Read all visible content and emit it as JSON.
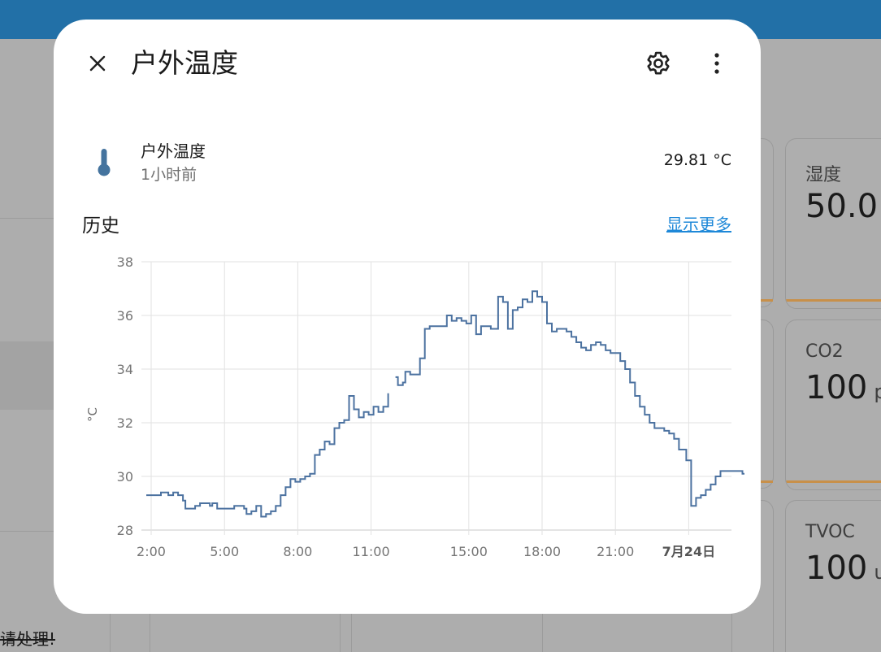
{
  "colors": {
    "topbar": "#2270a7",
    "backdrop": "#adadad",
    "series_line": "#4c72a0",
    "link": "#1e88d8"
  },
  "background": {
    "sensors": [
      {
        "name": "湿度",
        "value": "50.0",
        "unit": ""
      },
      {
        "name": "CO2",
        "value": "100",
        "unit": "p"
      },
      {
        "name": "TVOC",
        "value": "100",
        "unit": "u"
      }
    ],
    "struck_text": "请处理!"
  },
  "dialog": {
    "title": "户外温度",
    "close_icon": "close-icon",
    "settings_icon": "gear-icon",
    "more_icon": "more-vertical-icon",
    "entity": {
      "icon": "thermometer-icon",
      "name": "户外温度",
      "last_changed": "1小时前",
      "state": "29.81 °C"
    },
    "history": {
      "title": "历史",
      "show_more": "显示更多"
    }
  },
  "chart_data": {
    "type": "line",
    "ylabel": "°C",
    "ylim": [
      28,
      38
    ],
    "y_ticks": [
      "38",
      "36",
      "34",
      "32",
      "30",
      "28"
    ],
    "x_ticks": [
      {
        "label": "2:00",
        "hour": 2
      },
      {
        "label": "5:00",
        "hour": 5
      },
      {
        "label": "8:00",
        "hour": 8
      },
      {
        "label": "11:00",
        "hour": 11
      },
      {
        "label": "15:00",
        "hour": 15
      },
      {
        "label": "18:00",
        "hour": 18
      },
      {
        "label": "21:00",
        "hour": 21
      },
      {
        "label": "7月24日",
        "hour": 24,
        "bold": true
      }
    ],
    "xlim": [
      1.8,
      25.75
    ],
    "step": true,
    "series": [
      {
        "points": [
          [
            1.8,
            29.3
          ],
          [
            2.4,
            29.4
          ],
          [
            2.7,
            29.3
          ],
          [
            2.9,
            29.4
          ],
          [
            3.1,
            29.3
          ],
          [
            3.3,
            29.1
          ],
          [
            3.4,
            28.8
          ],
          [
            3.8,
            28.9
          ],
          [
            4.0,
            29.0
          ],
          [
            4.4,
            28.9
          ],
          [
            4.5,
            29.0
          ],
          [
            4.7,
            28.8
          ],
          [
            5.0,
            28.8
          ],
          [
            5.4,
            28.9
          ],
          [
            5.8,
            28.8
          ],
          [
            5.9,
            28.6
          ],
          [
            6.1,
            28.7
          ],
          [
            6.3,
            28.9
          ],
          [
            6.5,
            28.5
          ],
          [
            6.7,
            28.6
          ],
          [
            6.9,
            28.7
          ],
          [
            7.1,
            28.9
          ],
          [
            7.3,
            29.3
          ],
          [
            7.5,
            29.6
          ],
          [
            7.7,
            29.9
          ],
          [
            7.9,
            29.8
          ],
          [
            8.1,
            29.9
          ],
          [
            8.3,
            30.0
          ],
          [
            8.5,
            30.1
          ],
          [
            8.7,
            30.8
          ],
          [
            8.9,
            31.0
          ],
          [
            9.1,
            31.3
          ],
          [
            9.3,
            31.2
          ],
          [
            9.5,
            31.8
          ],
          [
            9.7,
            32.0
          ],
          [
            9.9,
            32.1
          ],
          [
            10.1,
            33.0
          ],
          [
            10.3,
            32.5
          ],
          [
            10.5,
            32.2
          ],
          [
            10.7,
            32.4
          ],
          [
            10.9,
            32.3
          ],
          [
            11.1,
            32.6
          ],
          [
            11.3,
            32.4
          ],
          [
            11.5,
            32.6
          ],
          [
            11.7,
            33.1
          ],
          [
            11.8,
            null
          ],
          [
            12.0,
            33.7
          ],
          [
            12.1,
            33.4
          ],
          [
            12.3,
            33.5
          ],
          [
            12.4,
            33.9
          ],
          [
            12.6,
            33.8
          ],
          [
            12.9,
            33.8
          ],
          [
            13.0,
            34.4
          ],
          [
            13.2,
            35.5
          ],
          [
            13.4,
            35.6
          ],
          [
            13.6,
            35.6
          ],
          [
            13.9,
            35.6
          ],
          [
            14.1,
            36.0
          ],
          [
            14.3,
            35.8
          ],
          [
            14.5,
            35.9
          ],
          [
            14.7,
            35.8
          ],
          [
            14.9,
            35.7
          ],
          [
            15.1,
            36.0
          ],
          [
            15.3,
            35.3
          ],
          [
            15.5,
            35.6
          ],
          [
            15.7,
            35.6
          ],
          [
            15.9,
            35.5
          ],
          [
            16.2,
            36.7
          ],
          [
            16.4,
            36.5
          ],
          [
            16.6,
            35.5
          ],
          [
            16.8,
            36.2
          ],
          [
            17.0,
            36.3
          ],
          [
            17.2,
            36.6
          ],
          [
            17.4,
            36.5
          ],
          [
            17.6,
            36.9
          ],
          [
            17.8,
            36.7
          ],
          [
            18.0,
            36.5
          ],
          [
            18.2,
            35.7
          ],
          [
            18.4,
            35.4
          ],
          [
            18.6,
            35.5
          ],
          [
            18.8,
            35.5
          ],
          [
            19.0,
            35.4
          ],
          [
            19.2,
            35.2
          ],
          [
            19.4,
            35.0
          ],
          [
            19.6,
            34.8
          ],
          [
            19.8,
            34.7
          ],
          [
            20.0,
            34.9
          ],
          [
            20.2,
            35.0
          ],
          [
            20.4,
            34.9
          ],
          [
            20.6,
            34.7
          ],
          [
            20.8,
            34.6
          ],
          [
            21.2,
            34.3
          ],
          [
            21.4,
            34.0
          ],
          [
            21.6,
            33.5
          ],
          [
            21.8,
            33.0
          ],
          [
            22.0,
            32.6
          ],
          [
            22.2,
            32.3
          ],
          [
            22.4,
            32.0
          ],
          [
            22.6,
            31.8
          ],
          [
            22.8,
            31.8
          ],
          [
            23.0,
            31.7
          ],
          [
            23.2,
            31.6
          ],
          [
            23.4,
            31.4
          ],
          [
            23.6,
            31.0
          ],
          [
            23.9,
            30.6
          ],
          [
            24.1,
            28.9
          ],
          [
            24.3,
            29.2
          ],
          [
            24.5,
            29.3
          ],
          [
            24.7,
            29.5
          ],
          [
            24.9,
            29.7
          ],
          [
            25.1,
            30.0
          ],
          [
            25.3,
            30.2
          ],
          [
            26.2,
            30.1
          ],
          [
            26.5,
            30.2
          ],
          [
            26.7,
            30.1
          ],
          [
            26.9,
            30.0
          ],
          [
            27.3,
            29.9
          ],
          [
            27.5,
            29.8
          ],
          [
            27.9,
            29.7
          ],
          [
            28.1,
            29.8
          ],
          [
            28.6,
            29.8
          ],
          [
            29.1,
            29.8
          ]
        ]
      }
    ]
  }
}
